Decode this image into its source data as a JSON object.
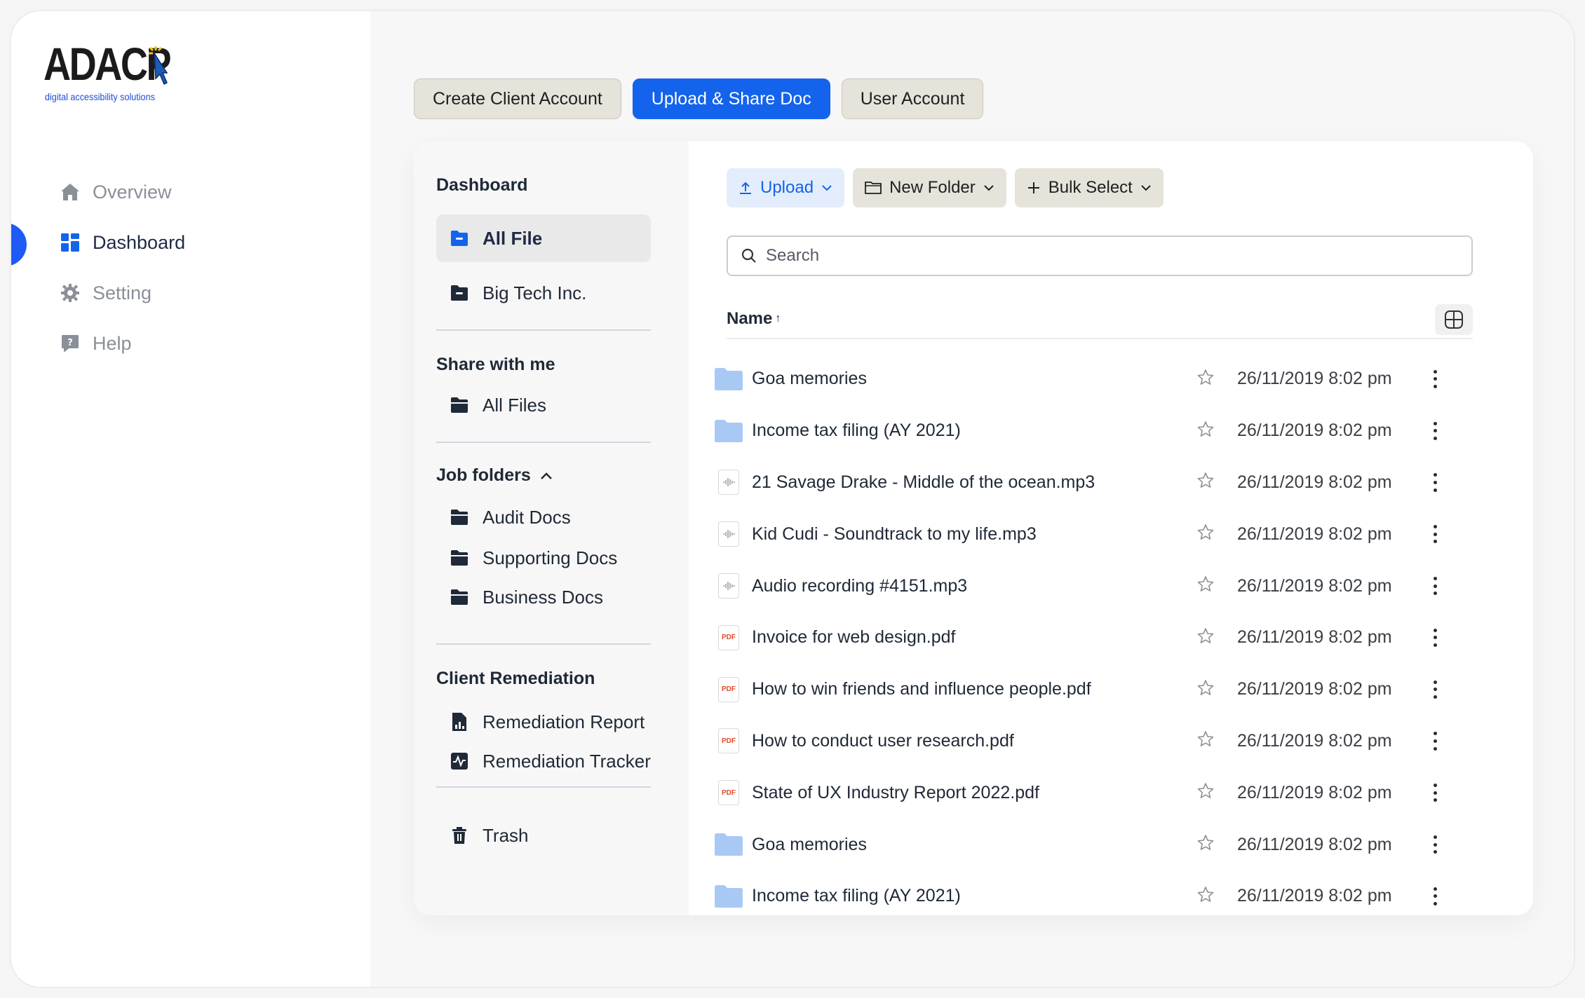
{
  "brand": {
    "name": "ADACP",
    "tagline": "digital accessibility solutions"
  },
  "nav": [
    {
      "label": "Overview",
      "icon": "home-icon",
      "active": false
    },
    {
      "label": "Dashboard",
      "icon": "grid-icon",
      "active": true
    },
    {
      "label": "Setting",
      "icon": "gear-icon",
      "active": false
    },
    {
      "label": "Help",
      "icon": "help-bubble-icon",
      "active": false
    }
  ],
  "top_buttons": {
    "create": "Create Client Account",
    "upload_share": "Upload & Share Doc",
    "user": "User Account"
  },
  "panel": {
    "dashboard_title": "Dashboard",
    "all_file": "All File",
    "big_tech": "Big Tech Inc.",
    "share_title": "Share with me",
    "all_files": "All Files",
    "job_title": "Job folders",
    "audit": "Audit Docs",
    "supporting": "Supporting Docs",
    "business": "Business Docs",
    "client_title": "Client Remediation",
    "report": "Remediation Report",
    "tracker": "Remediation Tracker",
    "trash": "Trash"
  },
  "toolbar": {
    "upload": "Upload",
    "new_folder": "New Folder",
    "bulk_select": "Bulk Select"
  },
  "search": {
    "placeholder": "Search"
  },
  "list": {
    "column_name": "Name",
    "sort_arrow": "↑",
    "files": [
      {
        "type": "folder",
        "name": "Goa memories",
        "date": "26/11/2019 8:02 pm"
      },
      {
        "type": "folder",
        "name": "Income tax filing (AY 2021)",
        "date": "26/11/2019 8:02 pm"
      },
      {
        "type": "audio",
        "name": "21 Savage Drake - Middle of the ocean.mp3",
        "date": "26/11/2019 8:02 pm"
      },
      {
        "type": "audio",
        "name": "Kid Cudi - Soundtrack to my life.mp3",
        "date": "26/11/2019 8:02 pm"
      },
      {
        "type": "audio",
        "name": "Audio recording #4151.mp3",
        "date": "26/11/2019 8:02 pm"
      },
      {
        "type": "pdf",
        "name": "Invoice for web design.pdf",
        "date": "26/11/2019 8:02 pm"
      },
      {
        "type": "pdf",
        "name": "How to win friends and influence people.pdf",
        "date": "26/11/2019 8:02 pm"
      },
      {
        "type": "pdf",
        "name": "How to conduct user research.pdf",
        "date": "26/11/2019 8:02 pm"
      },
      {
        "type": "pdf",
        "name": "State of UX Industry Report 2022.pdf",
        "date": "26/11/2019 8:02 pm"
      },
      {
        "type": "folder",
        "name": "Goa memories",
        "date": "26/11/2019 8:02 pm"
      },
      {
        "type": "folder",
        "name": "Income tax filing (AY 2021)",
        "date": "26/11/2019 8:02 pm"
      }
    ]
  },
  "colors": {
    "accent": "#1463ec",
    "folder": "#a9c9f5",
    "pdf_text": "#e14b2b"
  }
}
